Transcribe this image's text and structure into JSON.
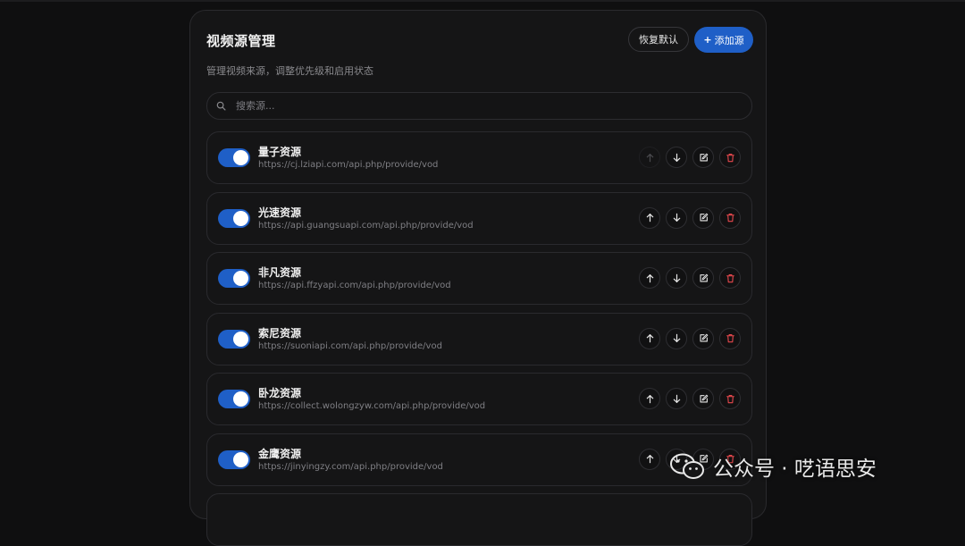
{
  "page": {
    "title": "视频源管理",
    "subtitle": "管理视频来源，调整优先级和启用状态",
    "reset_label": "恢复默认",
    "add_label": "添加源",
    "add_symbol": "+"
  },
  "search": {
    "placeholder": "搜索源..."
  },
  "sources": [
    {
      "name": "量子资源",
      "url": "https://cj.lziapi.com/api.php/provide/vod",
      "enabled": true
    },
    {
      "name": "光速资源",
      "url": "https://api.guangsuapi.com/api.php/provide/vod",
      "enabled": true
    },
    {
      "name": "非凡资源",
      "url": "https://api.ffzyapi.com/api.php/provide/vod",
      "enabled": true
    },
    {
      "name": "索尼资源",
      "url": "https://suoniapi.com/api.php/provide/vod",
      "enabled": true
    },
    {
      "name": "卧龙资源",
      "url": "https://collect.wolongzyw.com/api.php/provide/vod",
      "enabled": true
    },
    {
      "name": "金鹰资源",
      "url": "https://jinyingzy.com/api.php/provide/vod",
      "enabled": true
    }
  ],
  "watermark": {
    "text": "公众号 · 呓语思安"
  },
  "icons": {
    "search": "search-icon",
    "up": "arrow-up-icon",
    "down": "arrow-down-icon",
    "edit": "edit-icon",
    "delete": "trash-icon",
    "wechat": "wechat-icon"
  },
  "colors": {
    "accent": "#1f5fc7",
    "danger": "#e5484d",
    "background": "#0f0f10",
    "panel": "#151516"
  }
}
